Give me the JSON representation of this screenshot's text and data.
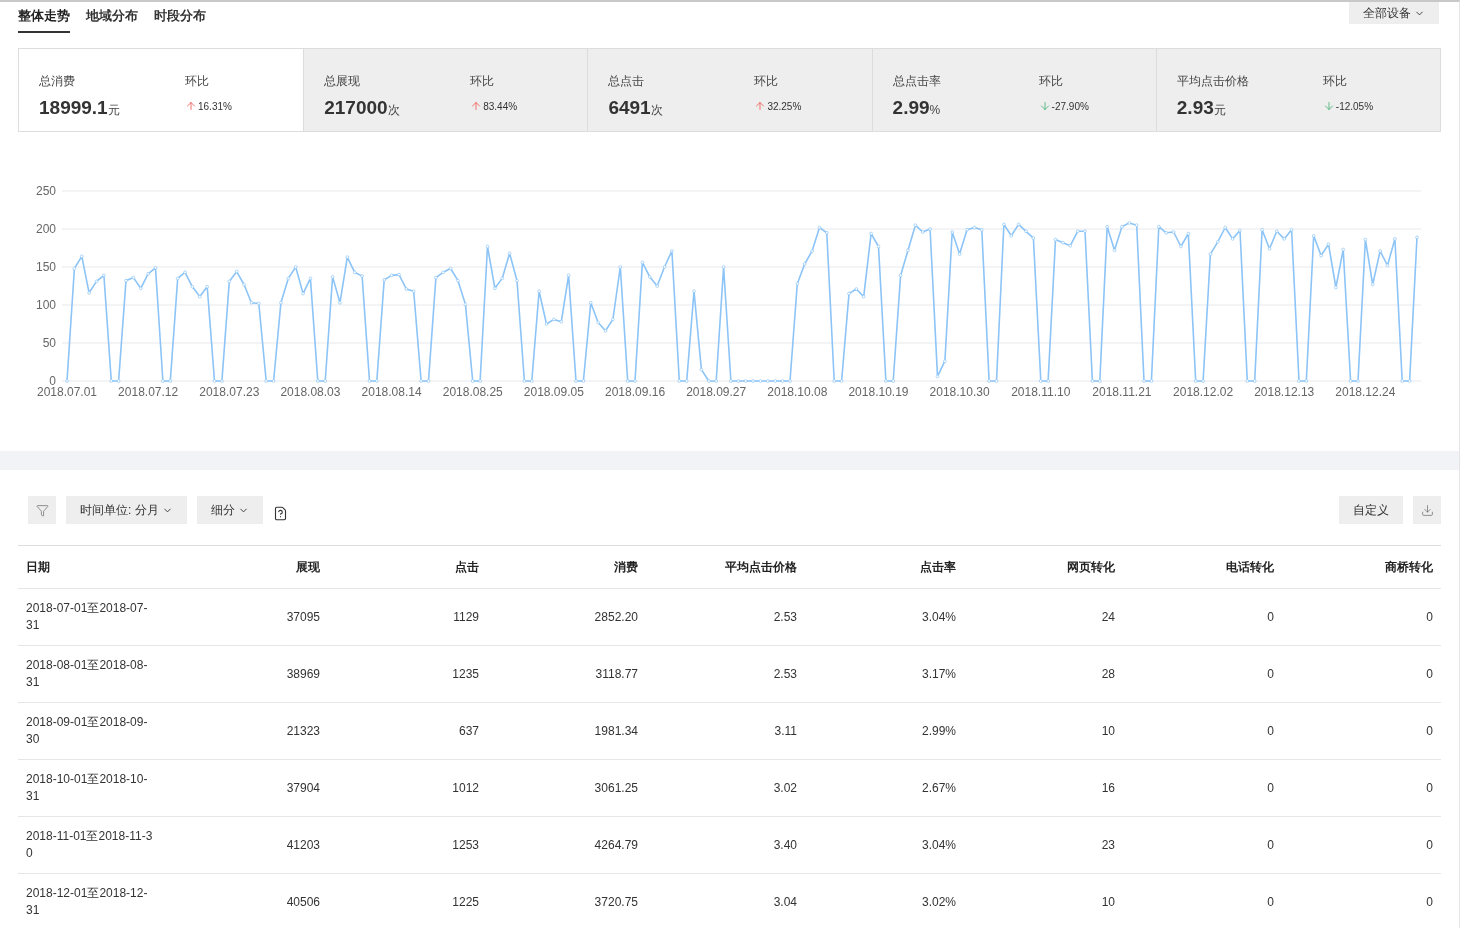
{
  "tabs": [
    {
      "label": "整体走势",
      "selected": true
    },
    {
      "label": "地域分布",
      "selected": false
    },
    {
      "label": "时段分布",
      "selected": false
    }
  ],
  "device_filter": {
    "label": "全部设备"
  },
  "stats": [
    {
      "label": "总消费",
      "value": "18999.1",
      "unit": "元",
      "change_label": "环比",
      "kind": "up",
      "change": "16.31%",
      "selected": true
    },
    {
      "label": "总展现",
      "value": "217000",
      "unit": "次",
      "change_label": "环比",
      "kind": "up",
      "change": "83.44%",
      "selected": false
    },
    {
      "label": "总点击",
      "value": "6491",
      "unit": "次",
      "change_label": "环比",
      "kind": "up",
      "change": "32.25%",
      "selected": false
    },
    {
      "label": "总点击率",
      "value": "2.99",
      "unit": "%",
      "change_label": "环比",
      "kind": "down",
      "change": "-27.90%",
      "selected": false
    },
    {
      "label": "平均点击价格",
      "value": "2.93",
      "unit": "元",
      "change_label": "环比",
      "kind": "down",
      "change": "-12.05%",
      "selected": false
    }
  ],
  "chart": {
    "chart_data": {
      "type": "line",
      "grid": true,
      "ylim": [
        0,
        250
      ],
      "yticks": [
        0,
        50,
        100,
        150,
        200,
        250
      ],
      "categories": [
        "2018.07.01",
        null,
        null,
        null,
        null,
        null,
        null,
        null,
        null,
        null,
        null,
        "2018.07.12",
        null,
        null,
        null,
        null,
        null,
        null,
        null,
        null,
        null,
        null,
        "2018.07.23",
        null,
        null,
        null,
        null,
        null,
        null,
        null,
        null,
        null,
        null,
        "2018.08.03",
        null,
        null,
        null,
        null,
        null,
        null,
        null,
        null,
        null,
        null,
        "2018.08.14",
        null,
        null,
        null,
        null,
        null,
        null,
        null,
        null,
        null,
        null,
        "2018.08.25",
        null,
        null,
        null,
        null,
        null,
        null,
        null,
        null,
        null,
        null,
        "2018.09.05",
        null,
        null,
        null,
        null,
        null,
        null,
        null,
        null,
        null,
        null,
        "2018.09.16",
        null,
        null,
        null,
        null,
        null,
        null,
        null,
        null,
        null,
        null,
        "2018.09.27",
        null,
        null,
        null,
        null,
        null,
        null,
        null,
        null,
        null,
        null,
        "2018.10.08",
        null,
        null,
        null,
        null,
        null,
        null,
        null,
        null,
        null,
        null,
        "2018.10.19",
        null,
        null,
        null,
        null,
        null,
        null,
        null,
        null,
        null,
        null,
        "2018.10.30",
        null,
        null,
        null,
        null,
        null,
        null,
        null,
        null,
        null,
        null,
        "2018.11.10",
        null,
        null,
        null,
        null,
        null,
        null,
        null,
        null,
        null,
        null,
        "2018.11.21",
        null,
        null,
        null,
        null,
        null,
        null,
        null,
        null,
        null,
        null,
        "2018.12.02",
        null,
        null,
        null,
        null,
        null,
        null,
        null,
        null,
        null,
        null,
        "2018.12.13",
        null,
        null,
        null,
        null,
        null,
        null,
        null,
        null,
        null,
        null,
        "2018.12.24",
        null,
        null,
        null,
        null,
        null,
        null,
        null
      ],
      "series": [
        {
          "color": "#8cc4f7",
          "marker": "circle",
          "values": [
            0,
            148,
            164,
            116,
            131,
            139,
            0,
            0,
            132,
            136,
            122,
            141,
            149,
            0,
            0,
            135,
            143,
            124,
            111,
            124,
            0,
            0,
            131,
            144,
            127,
            103,
            102,
            0,
            0,
            103,
            135,
            150,
            115,
            135,
            0,
            0,
            137,
            103,
            163,
            143,
            138,
            0,
            0,
            133,
            139,
            140,
            121,
            118,
            0,
            0,
            136,
            143,
            148,
            132,
            101,
            0,
            0,
            177,
            122,
            135,
            168,
            132,
            0,
            0,
            118,
            75,
            81,
            78,
            139,
            0,
            0,
            103,
            77,
            66,
            81,
            150,
            0,
            0,
            156,
            137,
            125,
            150,
            171,
            0,
            0,
            118,
            15,
            0,
            0,
            150,
            0,
            0,
            0,
            0,
            0,
            0,
            0,
            0,
            0,
            128,
            154,
            171,
            202,
            195,
            0,
            0,
            115,
            121,
            111,
            194,
            177,
            0,
            0,
            139,
            172,
            205,
            196,
            200,
            6,
            26,
            196,
            167,
            199,
            202,
            199,
            0,
            0,
            206,
            191,
            206,
            197,
            188,
            0,
            0,
            186,
            182,
            178,
            197,
            197,
            0,
            0,
            203,
            172,
            203,
            208,
            205,
            0,
            0,
            203,
            195,
            196,
            177,
            194,
            0,
            0,
            167,
            183,
            202,
            187,
            198,
            0,
            0,
            199,
            174,
            197,
            187,
            199,
            0,
            0,
            191,
            165,
            180,
            123,
            173,
            0,
            0,
            186,
            127,
            171,
            152,
            187,
            0,
            0,
            189
          ]
        }
      ]
    }
  },
  "toolbar": {
    "time_unit": "时间单位: 分月",
    "segment": "细分",
    "customize": "自定义"
  },
  "table": {
    "columns": [
      "日期",
      "展现",
      "点击",
      "消费",
      "平均点击价格",
      "点击率",
      "网页转化",
      "电话转化",
      "商桥转化"
    ],
    "rows": [
      [
        "2018-07-01至2018-07-31",
        "37095",
        "1129",
        "2852.20",
        "2.53",
        "3.04%",
        "24",
        "0",
        "0"
      ],
      [
        "2018-08-01至2018-08-31",
        "38969",
        "1235",
        "3118.77",
        "2.53",
        "3.17%",
        "28",
        "0",
        "0"
      ],
      [
        "2018-09-01至2018-09-30",
        "21323",
        "637",
        "1981.34",
        "3.11",
        "2.99%",
        "10",
        "0",
        "0"
      ],
      [
        "2018-10-01至2018-10-31",
        "37904",
        "1012",
        "3061.25",
        "3.02",
        "2.67%",
        "16",
        "0",
        "0"
      ],
      [
        "2018-11-01至2018-11-30",
        "41203",
        "1253",
        "4264.79",
        "3.40",
        "3.04%",
        "23",
        "0",
        "0"
      ],
      [
        "2018-12-01至2018-12-31",
        "40506",
        "1225",
        "3720.75",
        "3.04",
        "3.02%",
        "10",
        "0",
        "0"
      ]
    ]
  }
}
